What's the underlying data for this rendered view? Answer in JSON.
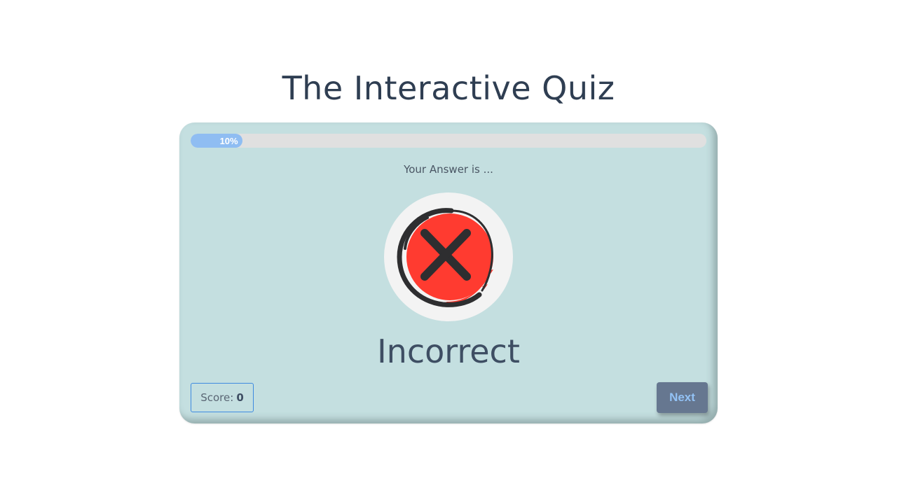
{
  "page": {
    "title": "The Interactive Quiz"
  },
  "quiz": {
    "progress": {
      "percent": 10,
      "label": "10%"
    },
    "prompt": "Your Answer is ...",
    "result": {
      "icon": "incorrect-x-icon",
      "text": "Incorrect",
      "color": "#ff3b30"
    },
    "score": {
      "label": "Score:",
      "value": "0"
    },
    "next_label": "Next"
  },
  "colors": {
    "card_bg": "#c4dfe0",
    "progress_fill": "#8fbdf2",
    "progress_track": "#e0e0e0",
    "button_bg": "#667790",
    "button_text": "#93c2f5",
    "score_border": "#3d8ae0",
    "title_text": "#2f3e52"
  }
}
